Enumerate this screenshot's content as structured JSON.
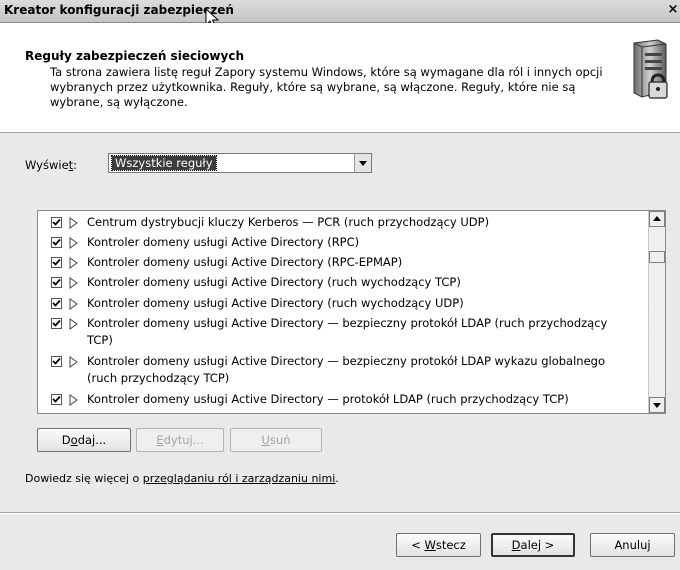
{
  "window": {
    "title": "Kreator konfiguracji zabezpieczeń",
    "close_label": "×"
  },
  "header": {
    "title": "Reguły zabezpieczeń sieciowych",
    "description": "Ta strona zawiera listę reguł Zapory systemu Windows, które są wymagane dla ról i innych opcji wybranych przez użytkownika. Reguły, które są wybrane, są włączone. Reguły, które nie są wybrane, są wyłączone.",
    "icon": "server-lock-icon"
  },
  "view": {
    "label_pre": "Wyświe",
    "label_accel": "t",
    "label_post": ":",
    "selected": "Wszystkie reguły"
  },
  "rules": [
    {
      "label": "Centrum dystrybucji kluczy Kerberos — PCR (ruch przychodzący UDP)",
      "checked": true
    },
    {
      "label": "Kontroler domeny usługi Active Directory (RPC)",
      "checked": true
    },
    {
      "label": "Kontroler domeny usługi Active Directory (RPC-EPMAP)",
      "checked": true
    },
    {
      "label": "Kontroler domeny usługi Active Directory (ruch wychodzący TCP)",
      "checked": true
    },
    {
      "label": "Kontroler domeny usługi Active Directory (ruch wychodzący UDP)",
      "checked": true
    },
    {
      "label": "Kontroler domeny usługi Active Directory — bezpieczny protokół LDAP (ruch przychodzący TCP)",
      "checked": true
    },
    {
      "label": "Kontroler domeny usługi Active Directory — bezpieczny protokół LDAP wykazu globalnego (ruch przychodzący TCP)",
      "checked": true
    },
    {
      "label": "Kontroler domeny usługi Active Directory — protokół LDAP (ruch przychodzący TCP)",
      "checked": true
    }
  ],
  "list_buttons": {
    "add_pre": "D",
    "add_accel": "o",
    "add_post": "daj...",
    "edit_pre": "",
    "edit_accel": "E",
    "edit_post": "dytuj...",
    "remove_pre": "",
    "remove_accel": "U",
    "remove_post": "suń"
  },
  "learn_more": {
    "prefix": "Dowiedz się więcej o ",
    "link": "przeglądaniu ról i zarządzaniu nimi",
    "suffix": "."
  },
  "nav": {
    "back_pre": "< ",
    "back_accel": "W",
    "back_post": "stecz",
    "next_pre": "",
    "next_accel": "D",
    "next_post": "alej >",
    "cancel": "Anuluj"
  }
}
